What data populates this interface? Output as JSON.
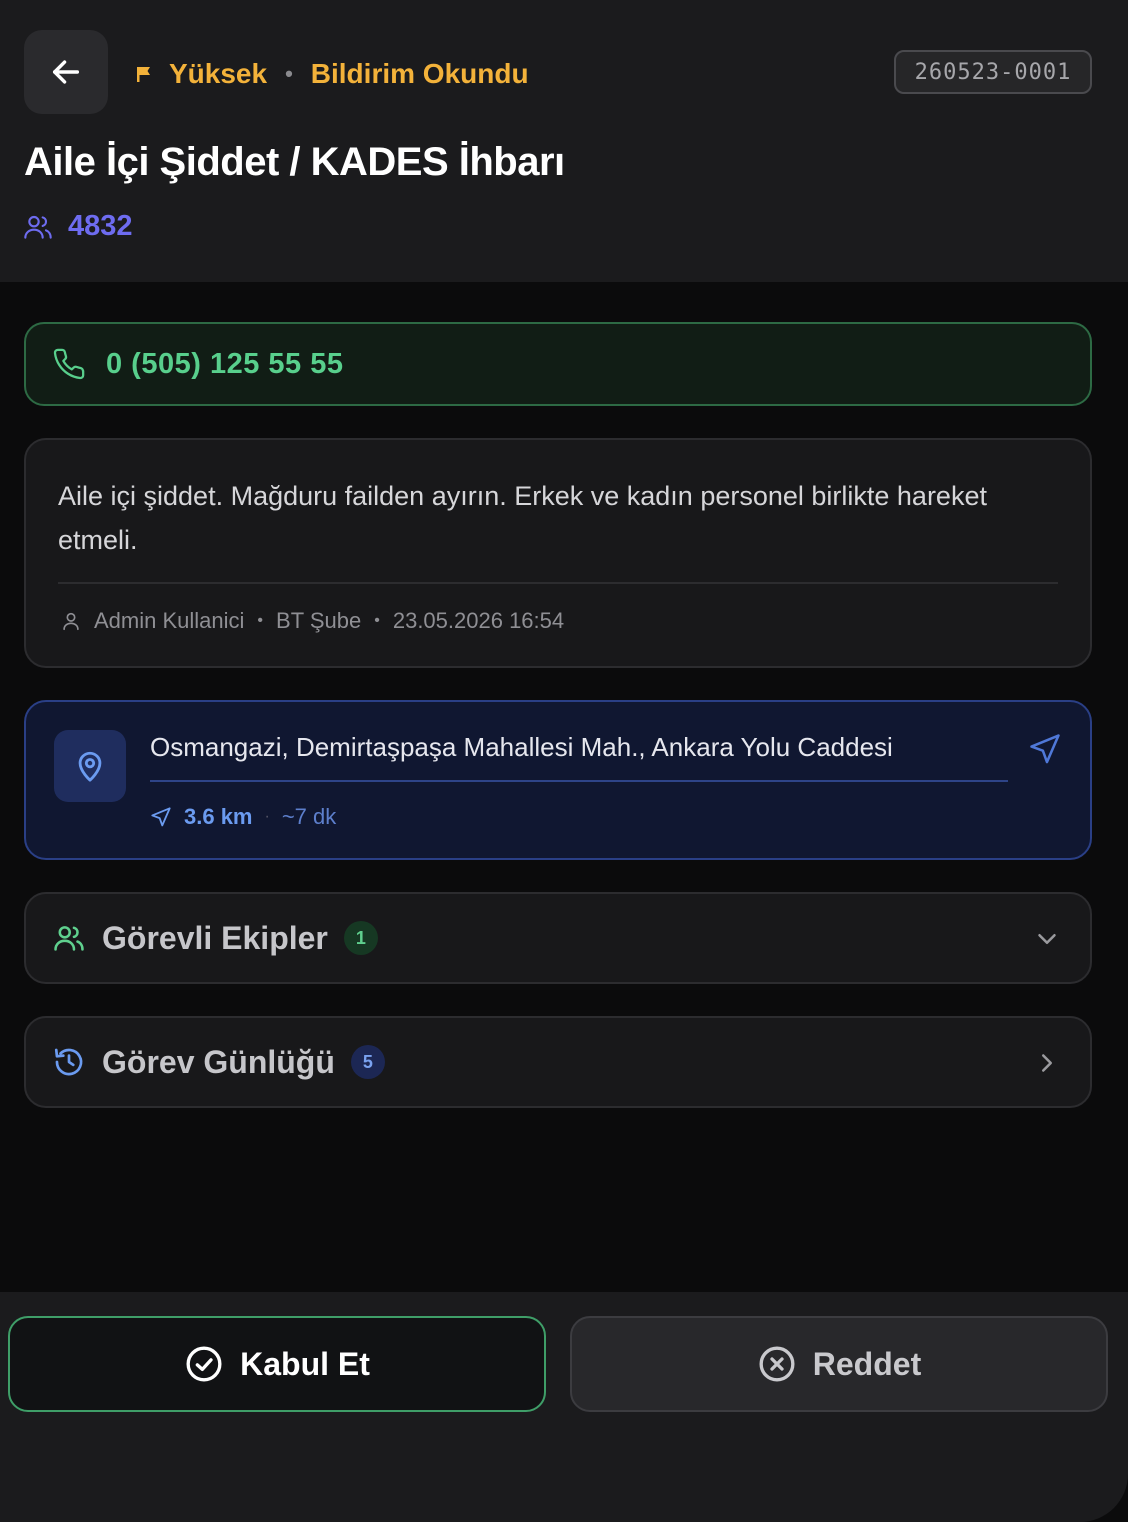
{
  "header": {
    "priority": "Yüksek",
    "status": "Bildirim Okundu",
    "case_id": "260523-0001",
    "title": "Aile İçi Şiddet / KADES İhbarı",
    "unit_code": "4832"
  },
  "phone": {
    "number": "0 (505) 125 55 55"
  },
  "note": {
    "text": "Aile içi şiddet. Mağduru failden ayırın. Erkek ve kadın personel birlikte hareket etmeli.",
    "author": "Admin Kullanici",
    "department": "BT Şube",
    "datetime": "23.05.2026 16:54"
  },
  "location": {
    "address": "Osmangazi, Demirtaşpaşa Mahallesi Mah., Ankara Yolu Caddesi",
    "distance": "3.6 km",
    "eta": "~7 dk"
  },
  "sections": {
    "teams": {
      "label": "Görevli Ekipler",
      "count": "1"
    },
    "log": {
      "label": "Görev Günlüğü",
      "count": "5"
    }
  },
  "actions": {
    "accept_label": "Kabul Et",
    "reject_label": "Reddet"
  },
  "colors": {
    "priority": "#f3b23a",
    "unit": "#6e6cf0",
    "phone": "#58cf8c",
    "location_accent": "#6b9bf0",
    "accept_border": "#3f9e68"
  },
  "icons": [
    "arrow-left-icon",
    "flag-icon",
    "users-icon",
    "phone-icon",
    "user-icon",
    "map-pin-icon",
    "navigation-icon",
    "history-icon",
    "chevron-down-icon",
    "chevron-right-icon",
    "check-circle-icon",
    "x-circle-icon"
  ]
}
